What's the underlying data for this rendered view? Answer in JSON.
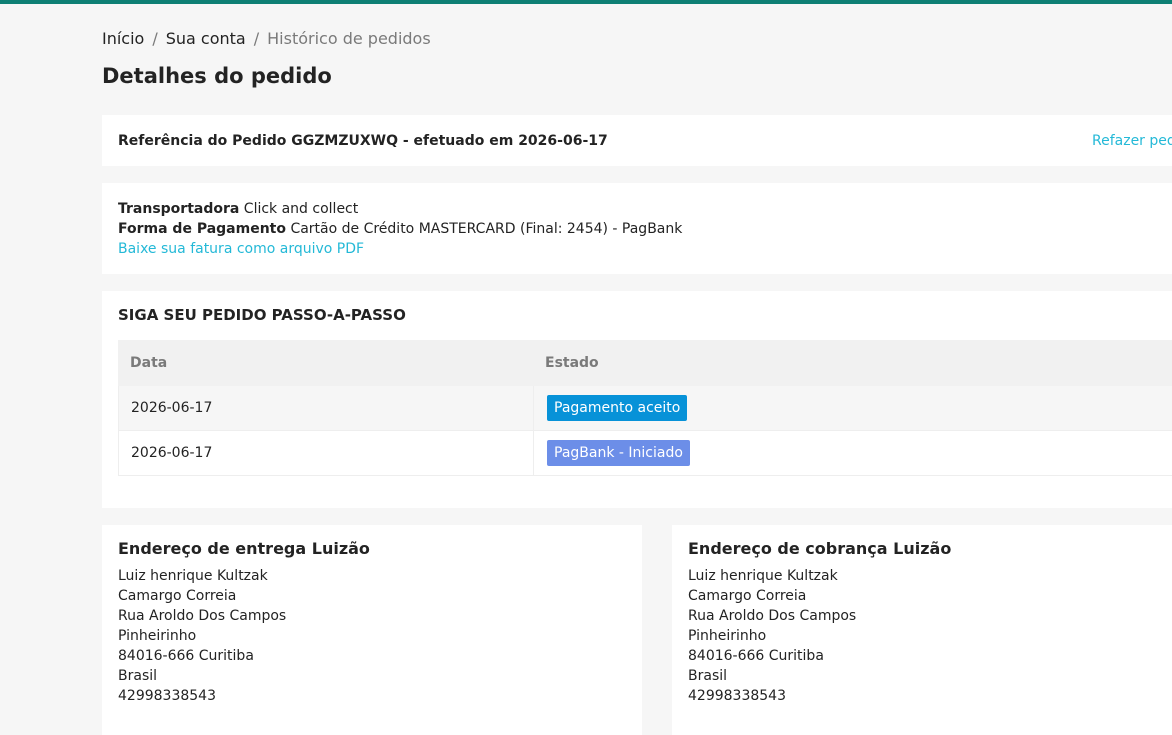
{
  "colors": {
    "accent_bar": "#0e7f74",
    "link": "#24b9d7",
    "badge_payment": "#0792d8",
    "badge_pagbank": "#6c8ee8"
  },
  "breadcrumb": {
    "home": "Início",
    "account": "Sua conta",
    "current": "Histórico de pedidos",
    "separator": "/"
  },
  "page_title": "Detalhes do pedido",
  "order": {
    "reference_text": "Referência do Pedido GGZMZUXWQ - efetuado em 2026-06-17",
    "reorder_label": "Refazer pedido"
  },
  "info": {
    "carrier_label": "Transportadora",
    "carrier_value": "Click and collect",
    "payment_label": "Forma de Pagamento",
    "payment_value": "Cartão de Crédito MASTERCARD (Final: 2454) - PagBank",
    "invoice_link": "Baixe sua fatura como arquivo PDF"
  },
  "tracking": {
    "title": "SIGA SEU PEDIDO PASSO-A-PASSO",
    "headers": {
      "date": "Data",
      "state": "Estado"
    },
    "rows": [
      {
        "date": "2026-06-17",
        "state": "Pagamento aceito",
        "state_color": "#0792d8"
      },
      {
        "date": "2026-06-17",
        "state": "PagBank - Iniciado",
        "state_color": "#6c8ee8"
      }
    ]
  },
  "delivery_address": {
    "title": "Endereço de entrega Luizão",
    "lines": [
      "Luiz henrique Kultzak",
      "Camargo Correia",
      "Rua Aroldo Dos Campos",
      "Pinheirinho",
      "84016-666 Curitiba",
      "Brasil",
      "42998338543"
    ]
  },
  "billing_address": {
    "title": "Endereço de cobrança Luizão",
    "lines": [
      "Luiz henrique Kultzak",
      "Camargo Correia",
      "Rua Aroldo Dos Campos",
      "Pinheirinho",
      "84016-666 Curitiba",
      "Brasil",
      "42998338543"
    ]
  }
}
